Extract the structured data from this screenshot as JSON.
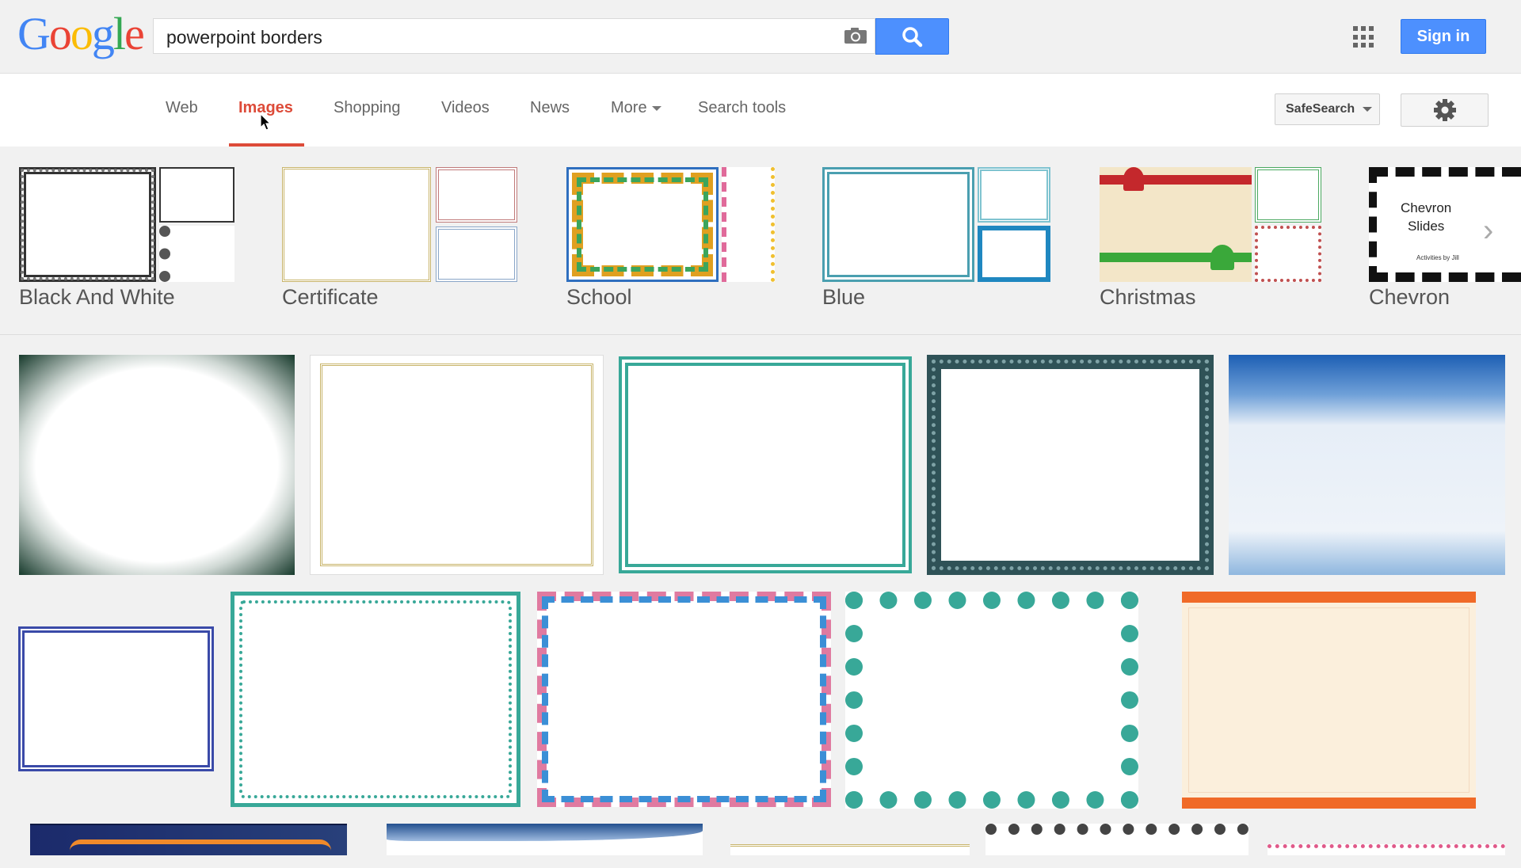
{
  "header": {
    "logo": "Google",
    "search_query": "powerpoint borders",
    "signin_label": "Sign in"
  },
  "nav": {
    "tabs": [
      {
        "label": "Web"
      },
      {
        "label": "Images"
      },
      {
        "label": "Shopping"
      },
      {
        "label": "Videos"
      },
      {
        "label": "News"
      },
      {
        "label": "More"
      },
      {
        "label": "Search tools"
      }
    ],
    "safesearch_label": "SafeSearch"
  },
  "related": [
    {
      "label": "Black And White"
    },
    {
      "label": "Certificate"
    },
    {
      "label": "School"
    },
    {
      "label": "Blue"
    },
    {
      "label": "Christmas"
    },
    {
      "label": "Chevron"
    }
  ],
  "chevron_thumb": {
    "line1": "Chevron",
    "line2": "Slides",
    "caption": "Activities by Jill"
  },
  "colors": {
    "accent_blue": "#4d90fe",
    "active_tab_red": "#dd4b39",
    "teal_border": "#38a898"
  }
}
